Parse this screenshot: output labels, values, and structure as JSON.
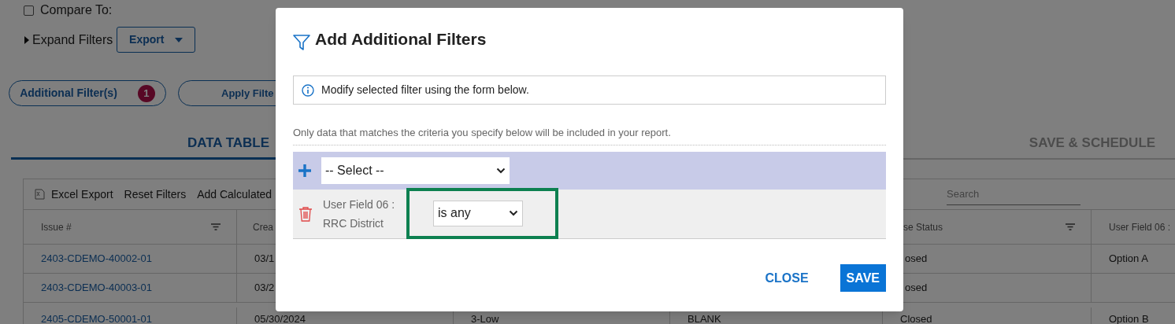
{
  "background": {
    "compare": {
      "label": "Compare To:",
      "checked": false
    },
    "expand_filters": {
      "label": "Expand Filters",
      "expanded": false
    },
    "export_button": {
      "label": "Export"
    },
    "action_buttons": [
      {
        "label": "Additional Filter(s)",
        "badge": "1"
      },
      {
        "label": "Apply Filte"
      }
    ],
    "tabs": [
      {
        "label": "DATA TABLE",
        "selected": true
      },
      {
        "label": "SAVE & SCHEDULE",
        "selected": false
      }
    ],
    "toolbar": [
      {
        "label": "Excel Export",
        "kind": "excel"
      },
      {
        "label": "Reset Filters",
        "kind": "plain"
      },
      {
        "label": "Add Calculated",
        "kind": "plain"
      }
    ],
    "search": {
      "placeholder": "Search"
    },
    "table": {
      "columns": [
        {
          "label": "Issue #",
          "filter_icon": true
        },
        {
          "label": "Crea"
        },
        {},
        {},
        {
          "label": "se Status",
          "filter_icon": true
        },
        {
          "label": "User Field 06 :"
        }
      ],
      "rows": [
        {
          "cells": [
            "2403-CDEMO-40002-01",
            "03/1",
            null,
            null,
            "osed",
            "Option A"
          ]
        },
        {
          "cells": [
            "2403-CDEMO-40003-01",
            "03/2",
            null,
            null,
            "osed",
            null
          ]
        },
        {
          "cells": [
            "2405-CDEMO-50001-01",
            "05/30/2024",
            "3-Low",
            "BLANK",
            "Closed",
            "Option B"
          ]
        }
      ]
    }
  },
  "modal": {
    "title": "Add Additional Filters",
    "info": "Modify selected filter using the form below.",
    "hint": "Only data that matches the criteria you specify below will be included in your report.",
    "add_select": {
      "value": "-- Select --"
    },
    "filters": [
      {
        "label": "User Field 06 : RRC District",
        "operator": "is any",
        "highlighted": true
      }
    ],
    "buttons": [
      {
        "label": "CLOSE",
        "kind": "text"
      },
      {
        "label": "SAVE",
        "kind": "primary"
      }
    ]
  }
}
